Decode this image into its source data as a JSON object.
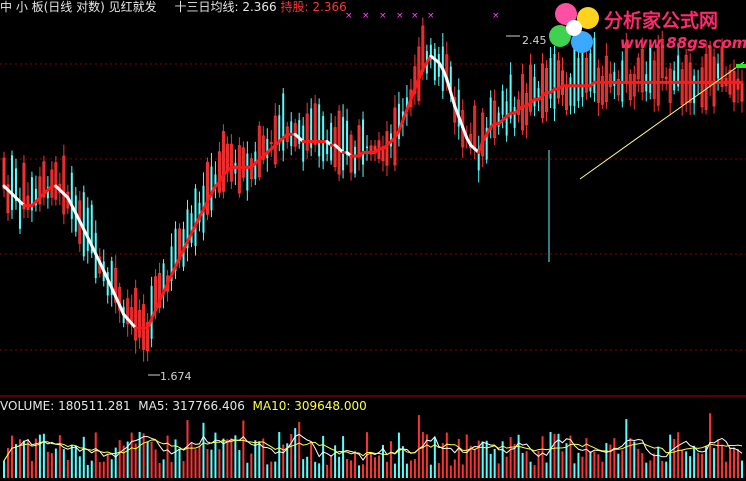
{
  "header": {
    "stock_name": "中 小 板(日线 对数) 见红就发",
    "ma13_label": "十三日均线:",
    "ma13_value": "2.366",
    "hold_label": "持股:",
    "hold_value": "2.366"
  },
  "volume_header": {
    "volume_label": "VOLUME:",
    "volume_value": "180511.281",
    "ma5_label": "MA5:",
    "ma5_value": "317766.406",
    "ma10_label": "MA10:",
    "ma10_value": "309648.000"
  },
  "watermark": {
    "title": "分析家公式网",
    "url": "www.88gs.com"
  },
  "colors": {
    "background": "#000000",
    "grid": "#8b0000",
    "up_candle": "#ff3232",
    "down_candle": "#54ffff",
    "ma_hold": "#ff1a1a",
    "ma_wait": "#ffffff",
    "trendline": "#ffff80",
    "signal_marker": "#ff44ff",
    "volume_ma5": "#ffffff",
    "volume_ma10": "#ffff40"
  },
  "chart_data": [
    {
      "type": "candlestick",
      "title": "中 小 板(日线 对数) 见红就发",
      "scale": "log",
      "grid": true,
      "x": [
        1,
        2,
        3,
        4,
        5,
        6,
        7,
        8,
        9,
        10,
        11,
        12,
        13,
        14,
        15,
        16,
        17,
        18,
        19,
        20,
        21,
        22,
        23,
        24,
        25,
        26,
        27,
        28,
        29,
        30,
        31,
        32,
        33,
        34,
        35,
        36,
        37,
        38,
        39,
        40,
        41,
        42,
        43,
        44,
        45,
        46,
        47,
        48,
        49,
        50,
        51,
        52,
        53,
        54,
        55,
        56,
        57,
        58,
        59,
        60,
        61,
        62,
        63,
        64,
        65,
        66,
        67,
        68,
        69,
        70,
        71,
        72,
        73,
        74,
        75,
        76,
        77,
        78,
        79,
        80,
        81,
        82,
        83,
        84,
        85,
        86,
        87,
        88,
        89,
        90,
        91,
        92,
        93,
        94,
        95,
        96,
        97,
        98,
        99,
        100,
        101,
        102,
        103,
        104,
        105,
        106,
        107,
        108,
        109,
        110,
        111,
        112,
        113,
        114,
        115,
        116,
        117,
        118,
        119,
        120,
        121,
        122,
        123,
        124,
        125,
        126,
        127,
        128,
        129,
        130,
        131,
        132,
        133,
        134,
        135,
        136,
        137,
        138,
        139,
        140,
        141,
        142,
        143,
        144,
        145,
        146,
        147,
        148,
        149,
        150,
        151,
        152,
        153,
        154,
        155,
        156,
        157,
        158,
        159,
        160,
        161,
        162,
        163,
        164,
        165,
        166,
        167,
        168,
        169,
        170,
        171,
        172,
        173,
        174,
        175,
        176,
        177,
        178,
        179,
        180,
        181,
        182,
        183,
        184,
        185,
        186
      ],
      "close_series": [
        {
          "name": "十三日均线",
          "values": [
            2.08,
            2.07,
            2.06,
            2.05,
            2.04,
            2.03,
            2.03,
            2.03,
            2.04,
            2.05,
            2.06,
            2.07,
            2.08,
            2.08,
            2.07,
            2.06,
            2.05,
            2.03,
            2.01,
            1.99,
            1.97,
            1.95,
            1.93,
            1.91,
            1.89,
            1.87,
            1.85,
            1.83,
            1.81,
            1.79,
            1.77,
            1.76,
            1.75,
            1.74,
            1.74,
            1.74,
            1.74,
            1.76,
            1.78,
            1.8,
            1.82,
            1.84,
            1.86,
            1.88,
            1.9,
            1.92,
            1.94,
            1.96,
            1.98,
            2.0,
            2.02,
            2.04,
            2.06,
            2.08,
            2.09,
            2.11,
            2.12,
            2.13,
            2.13,
            2.13,
            2.13,
            2.13,
            2.13,
            2.14,
            2.15,
            2.16,
            2.17,
            2.18,
            2.19,
            2.2,
            2.21,
            2.22,
            2.22,
            2.22,
            2.21,
            2.2,
            2.2,
            2.2,
            2.2,
            2.2,
            2.2,
            2.2,
            2.19,
            2.19,
            2.18,
            2.17,
            2.17,
            2.16,
            2.16,
            2.16,
            2.17,
            2.17,
            2.17,
            2.17,
            2.18,
            2.18,
            2.19,
            2.2,
            2.21,
            2.23,
            2.26,
            2.29,
            2.32,
            2.35,
            2.38,
            2.41,
            2.43,
            2.45,
            2.44,
            2.43,
            2.41,
            2.38,
            2.34,
            2.3,
            2.27,
            2.24,
            2.21,
            2.19,
            2.18,
            2.17,
            2.2,
            2.22,
            2.24,
            2.25,
            2.25,
            2.26,
            2.27,
            2.28,
            2.28,
            2.29,
            2.3,
            2.3,
            2.31,
            2.32,
            2.32,
            2.33,
            2.34,
            2.34,
            2.35,
            2.35,
            2.36,
            2.36,
            2.36,
            2.36,
            2.36,
            2.36,
            2.36,
            2.36,
            2.37,
            2.37,
            2.37,
            2.37,
            2.37,
            2.37,
            2.37,
            2.37,
            2.37,
            2.37,
            2.37,
            2.37,
            2.37,
            2.37,
            2.37,
            2.37,
            2.37,
            2.37,
            2.37,
            2.37,
            2.37,
            2.37,
            2.37,
            2.37,
            2.37,
            2.37,
            2.37,
            2.37,
            2.37,
            2.37,
            2.37,
            2.37,
            2.37,
            2.37,
            2.37,
            2.37,
            2.37,
            2.37
          ]
        }
      ],
      "annotations": [
        {
          "text": "2.45",
          "x": 127,
          "y": 2.45
        },
        {
          "text": "1.674",
          "x": 37,
          "y": 1.674
        }
      ]
    },
    {
      "type": "bar",
      "name": "VOLUME",
      "series": [
        {
          "name": "MA5",
          "last": 317766.406
        },
        {
          "name": "MA10",
          "last": 309648.0
        }
      ],
      "last_volume": 180511.281
    }
  ]
}
